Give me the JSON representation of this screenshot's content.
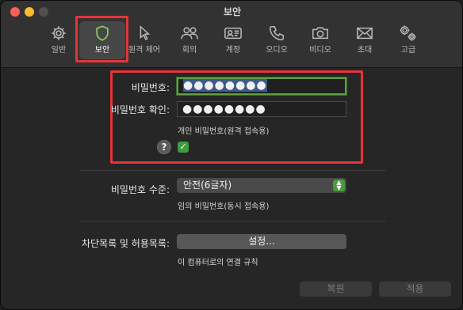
{
  "window": {
    "title": "보안"
  },
  "tabs": [
    {
      "id": "general",
      "label": "일반",
      "icon": "gear-icon"
    },
    {
      "id": "security",
      "label": "보안",
      "icon": "shield-icon",
      "active": true
    },
    {
      "id": "remote",
      "label": "원격 제어",
      "icon": "pointer-icon"
    },
    {
      "id": "meeting",
      "label": "회의",
      "icon": "people-icon"
    },
    {
      "id": "account",
      "label": "계정",
      "icon": "id-card-icon"
    },
    {
      "id": "audio",
      "label": "오디오",
      "icon": "phone-icon"
    },
    {
      "id": "video",
      "label": "비디오",
      "icon": "camera-icon"
    },
    {
      "id": "invite",
      "label": "초대",
      "icon": "envelope-icon"
    },
    {
      "id": "advanced",
      "label": "고급",
      "icon": "gears-icon"
    }
  ],
  "password": {
    "label": "비밀번호:",
    "value": "●●●●●●●●",
    "confirm_label": "비밀번호 확인:",
    "confirm_value": "●●●●●●●●",
    "hint": "개인 비밀번호(원격 접속용)",
    "help_glyph": "?",
    "check_glyph": "✓"
  },
  "level": {
    "label": "비밀번호 수준:",
    "selected": "안전(6글자)",
    "hint": "임의 비밀번호(동시 접속용)"
  },
  "blocklist": {
    "label": "차단목록 및 허용목록:",
    "button": "설정...",
    "hint": "이 컴퓨터로의 연결 규칙"
  },
  "footer": {
    "revert": "복원",
    "apply": "적용"
  },
  "colors": {
    "accent": "#5da143",
    "highlight": "#e7333a"
  }
}
